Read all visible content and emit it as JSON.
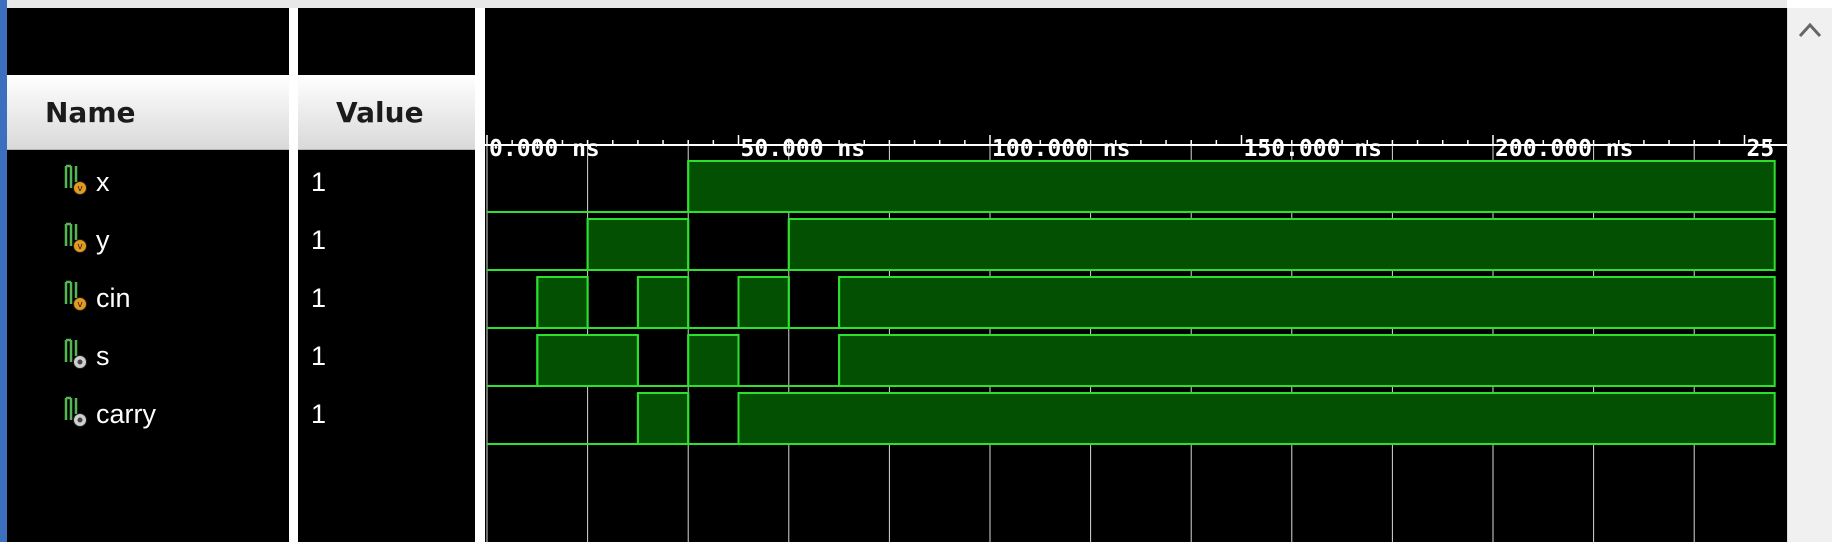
{
  "columns": {
    "name": "Name",
    "value": "Value"
  },
  "signals": [
    {
      "name": "x",
      "value": "1",
      "kind": "input-port-icon"
    },
    {
      "name": "y",
      "value": "1",
      "kind": "input-port-icon"
    },
    {
      "name": "cin",
      "value": "1",
      "kind": "input-port-icon"
    },
    {
      "name": "s",
      "value": "1",
      "kind": "output-port-icon"
    },
    {
      "name": "carry",
      "value": "1",
      "kind": "output-port-icon"
    }
  ],
  "timeline": {
    "tick_labels": [
      "0.000 ns",
      "50.000 ns",
      "100.000 ns",
      "150.000 ns",
      "200.000 ns",
      "25"
    ],
    "unit": "ns",
    "transitions_ns": {
      "x": [
        [
          0,
          0
        ],
        [
          40,
          1
        ]
      ],
      "y": [
        [
          0,
          0
        ],
        [
          20,
          1
        ],
        [
          40,
          0
        ],
        [
          60,
          1
        ]
      ],
      "cin": [
        [
          0,
          0
        ],
        [
          10,
          1
        ],
        [
          20,
          0
        ],
        [
          30,
          1
        ],
        [
          40,
          0
        ],
        [
          50,
          1
        ],
        [
          60,
          0
        ],
        [
          70,
          1
        ]
      ],
      "s": [
        [
          0,
          0
        ],
        [
          10,
          1
        ],
        [
          30,
          0
        ],
        [
          40,
          1
        ],
        [
          50,
          0
        ],
        [
          70,
          1
        ]
      ],
      "carry": [
        [
          0,
          0
        ],
        [
          30,
          1
        ],
        [
          40,
          0
        ],
        [
          50,
          1
        ]
      ]
    }
  },
  "colors": {
    "wave_line": "#2ee02e",
    "wave_fill": "#035003",
    "grid": "#d8d8d8",
    "background": "#000000",
    "input_icon_dot": "#e39a1f",
    "output_icon_dot": "#cfcfcf"
  }
}
